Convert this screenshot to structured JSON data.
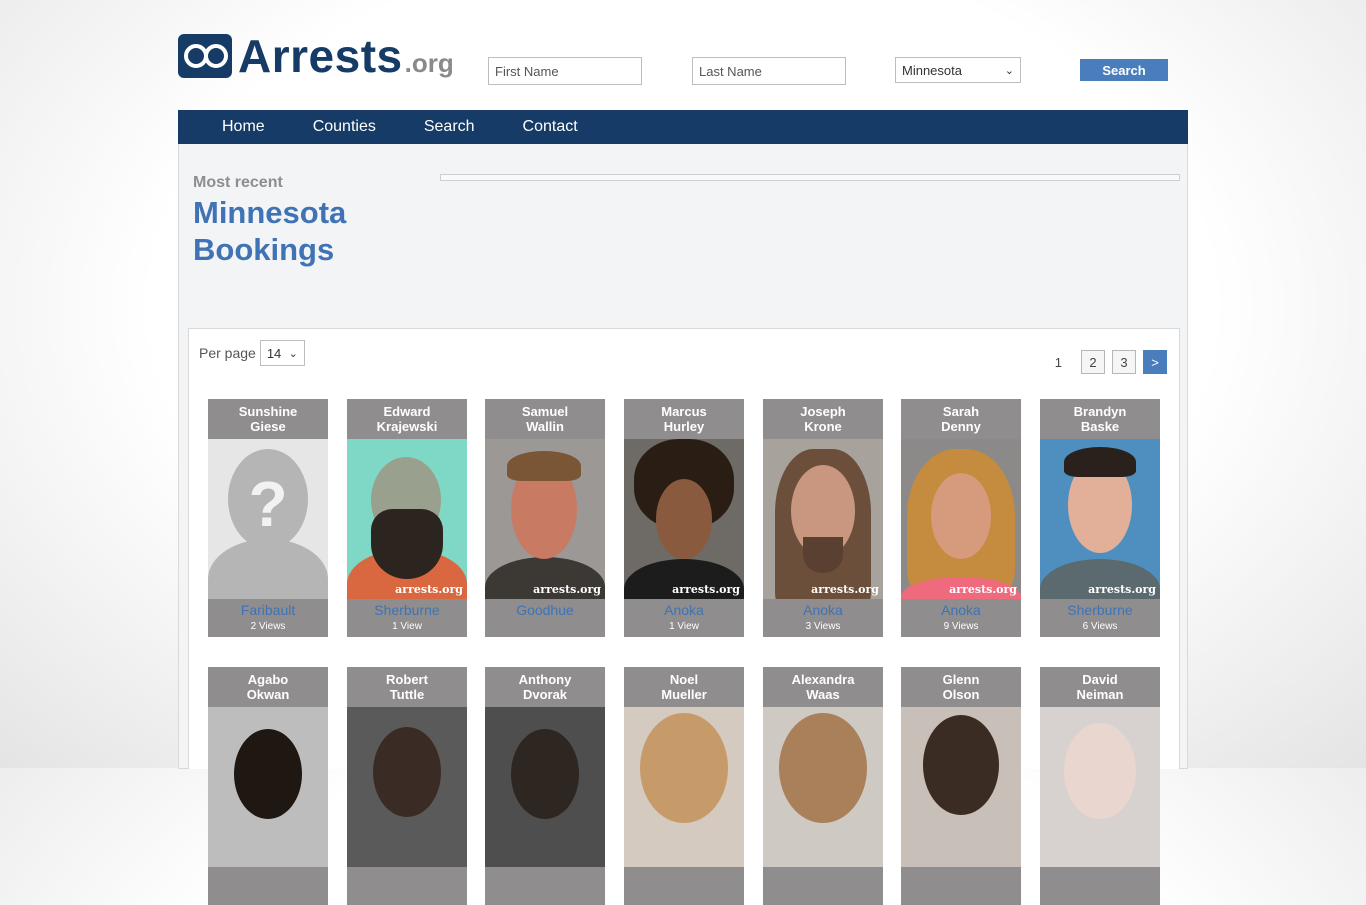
{
  "header": {
    "logo_word": "Arrests",
    "logo_tld": ".org",
    "first_name_placeholder": "First Name",
    "last_name_placeholder": "Last Name",
    "state_selected": "Minnesota",
    "search_label": "Search"
  },
  "nav": [
    "Home",
    "Counties",
    "Search",
    "Contact"
  ],
  "page": {
    "subtitle": "Most recent",
    "title_line1": "Minnesota",
    "title_line2": "Bookings"
  },
  "list": {
    "per_page_label": "Per page",
    "per_page_value": "14",
    "pagination": {
      "current": "1",
      "pages": [
        "2",
        "3"
      ],
      "next": ">"
    },
    "watermark": "arrests.org",
    "row1": [
      {
        "first": "Sunshine",
        "last": "Giese",
        "county": "Faribault",
        "views": "2 Views"
      },
      {
        "first": "Edward",
        "last": "Krajewski",
        "county": "Sherburne",
        "views": "1 View"
      },
      {
        "first": "Samuel",
        "last": "Wallin",
        "county": "Goodhue",
        "views": ""
      },
      {
        "first": "Marcus",
        "last": "Hurley",
        "county": "Anoka",
        "views": "1 View"
      },
      {
        "first": "Joseph",
        "last": "Krone",
        "county": "Anoka",
        "views": "3 Views"
      },
      {
        "first": "Sarah",
        "last": "Denny",
        "county": "Anoka",
        "views": "9 Views"
      },
      {
        "first": "Brandyn",
        "last": "Baske",
        "county": "Sherburne",
        "views": "6 Views"
      }
    ],
    "row2": [
      {
        "first": "Agabo",
        "last": "Okwan"
      },
      {
        "first": "Robert",
        "last": "Tuttle"
      },
      {
        "first": "Anthony",
        "last": "Dvorak"
      },
      {
        "first": "Noel",
        "last": "Mueller"
      },
      {
        "first": "Alexandra",
        "last": "Waas"
      },
      {
        "first": "Glenn",
        "last": "Olson"
      },
      {
        "first": "David",
        "last": "Neiman"
      }
    ]
  }
}
